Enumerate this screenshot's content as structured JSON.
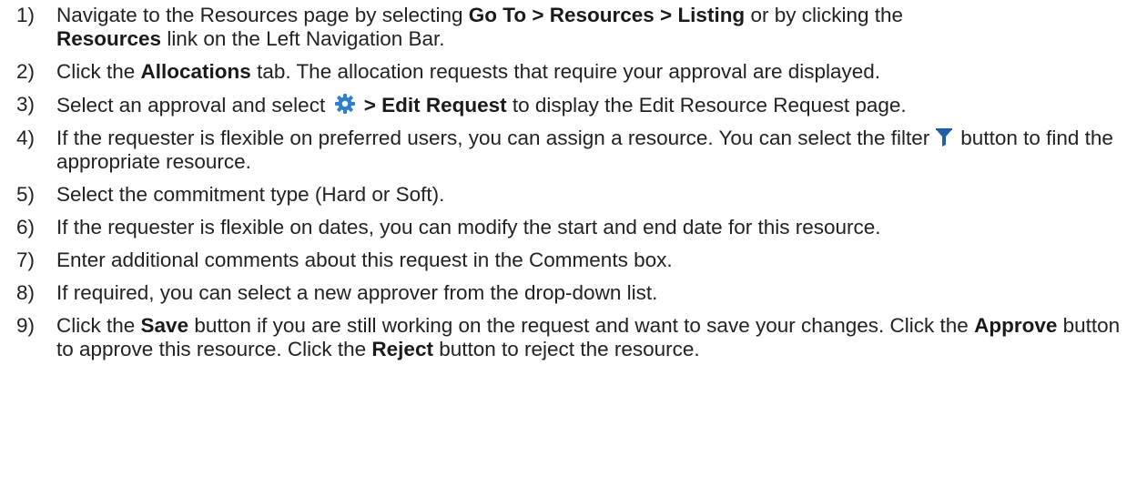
{
  "steps": [
    {
      "num": "1)",
      "t1": "Navigate to the Resources page by selecting ",
      "b1": "Go To > Resources > Listing",
      "t2": " or by clicking the ",
      "b2": "Resources",
      "t3": " link on the Left Navigation Bar."
    },
    {
      "num": "2)",
      "t1": "Click the ",
      "b1": "Allocations",
      "t2": " tab. The allocation requests that require your approval are displayed."
    },
    {
      "num": "3)",
      "t1": "Select an approval and select ",
      "icon": "gear-icon",
      "b1": " > Edit Request",
      "t2": " to display the Edit Resource Request page."
    },
    {
      "num": "4)",
      "t1": "If the requester is flexible on preferred users, you can assign a resource. You can select the filter",
      "icon": "filter-icon",
      "t2": "button to find the appropriate resource."
    },
    {
      "num": "5)",
      "t1": "Select the commitment type (Hard or Soft)."
    },
    {
      "num": "6)",
      "t1": "If the requester is flexible on dates, you can modify the start and end date for this resource."
    },
    {
      "num": "7)",
      "t1": "Enter additional comments about this request in the Comments box."
    },
    {
      "num": "8)",
      "t1": "If required, you can select a new approver from the drop-down list."
    },
    {
      "num": "9)",
      "t1": "Click the ",
      "b1": "Save",
      "t2": " button if you are still working on the request and want to save your changes. Click the ",
      "b2": "Approve",
      "t3": " button to approve this resource. Click the ",
      "b3": "Reject",
      "t4": " button to reject the resource."
    }
  ],
  "colors": {
    "text": "#222222",
    "gear_icon": "#2f7fd1",
    "filter_icon": "#1f5fa8"
  }
}
